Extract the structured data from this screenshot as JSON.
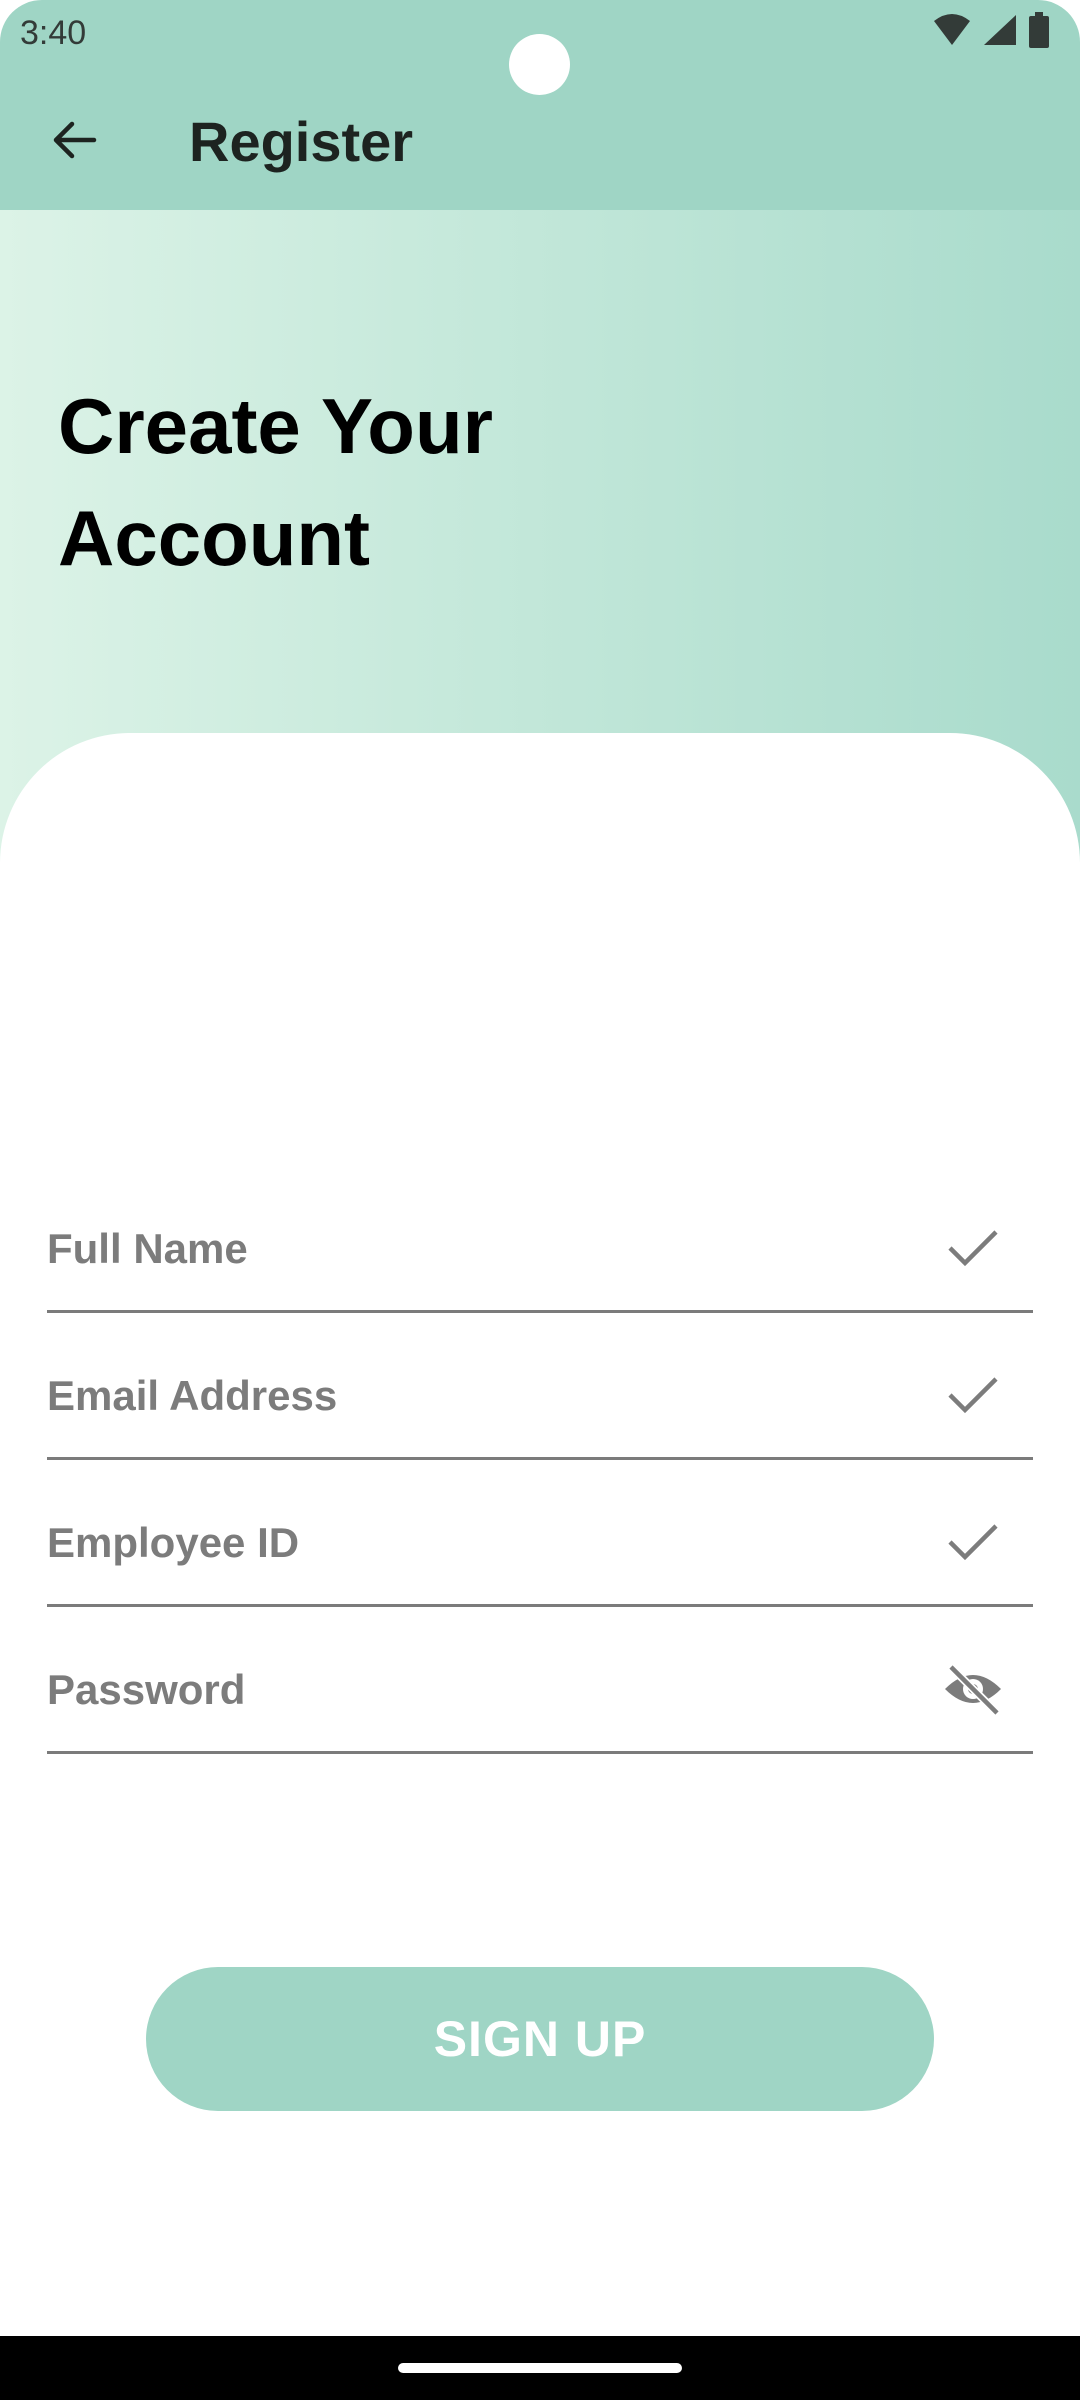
{
  "status_bar": {
    "time": "3:40",
    "icons": [
      "wifi-icon",
      "signal-icon",
      "battery-icon"
    ]
  },
  "app_bar": {
    "back_icon": "arrow-back-icon",
    "title": "Register"
  },
  "hero": {
    "title": "Create Your Account"
  },
  "form": {
    "fields": [
      {
        "placeholder": "Full Name",
        "icon": "check-icon"
      },
      {
        "placeholder": "Email Address",
        "icon": "check-icon"
      },
      {
        "placeholder": "Employee ID",
        "icon": "check-icon"
      },
      {
        "placeholder": "Password",
        "icon": "visibility-off-icon"
      }
    ]
  },
  "signup_button": {
    "label": "SIGN UP"
  },
  "colors": {
    "primary": "#9fd5c5",
    "gradient_start": "#dcf3e7",
    "gradient_end": "#a9dbcc",
    "field_text": "#7c7c7c"
  }
}
